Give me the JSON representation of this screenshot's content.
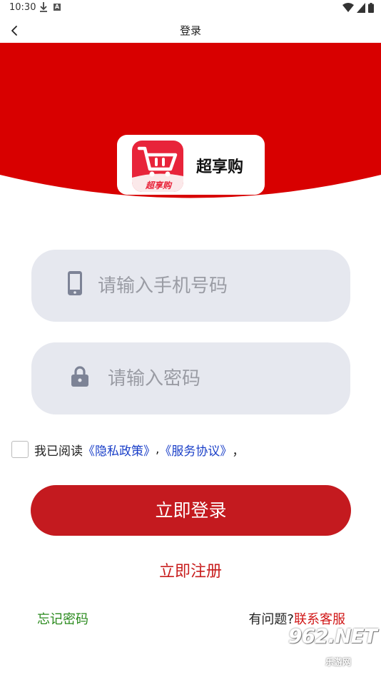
{
  "status_bar": {
    "time": "10:30"
  },
  "app_bar": {
    "title": "登录"
  },
  "brand": {
    "name": "超享购",
    "icon_label": "超享购"
  },
  "colors": {
    "primary_red": "#c41a1f",
    "hero_red": "#d80000",
    "link_blue": "#1a3fc8",
    "forgot_green": "#2a8a1d",
    "input_bg": "#e6e8ef"
  },
  "form": {
    "phone": {
      "placeholder": "请输入手机号码",
      "value": "",
      "icon": "phone-icon"
    },
    "password": {
      "placeholder": "请输入密码",
      "value": "",
      "icon": "lock-icon"
    }
  },
  "agreement": {
    "checked": false,
    "prefix": "我已阅读",
    "privacy_link": "《隐私政策》",
    "separator": ",",
    "service_link": "《服务协议》",
    "suffix": "，"
  },
  "actions": {
    "login_label": "立即登录",
    "register_label": "立即注册",
    "forgot_label": "忘记密码",
    "help_prefix": "有问题?",
    "contact_label": "联系客服"
  },
  "watermark": {
    "main": "962.NET",
    "sub": "乐游网"
  }
}
